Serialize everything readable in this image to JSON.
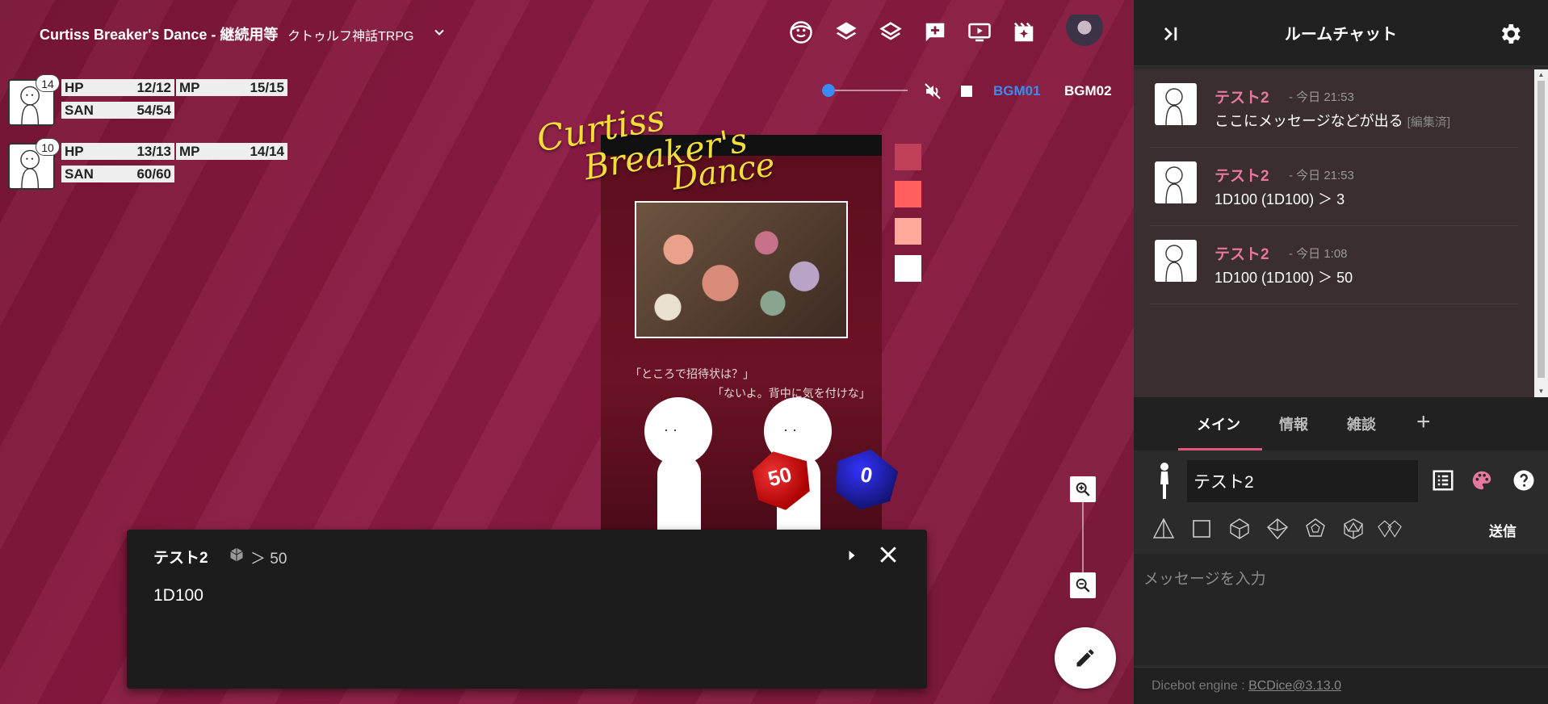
{
  "room": {
    "title": "Curtiss Breaker's Dance - 継続用等",
    "system": "クトゥルフ神話TRPG"
  },
  "toolbar_icons": [
    "face-icon",
    "layers-icon",
    "layers-outline-icon",
    "add-comment-icon",
    "screen-icon",
    "movie-sparkle-icon"
  ],
  "audio": {
    "volume": 0.05,
    "bgm1": "BGM01",
    "bgm2": "BGM02",
    "bgm1_color": "#3b8bf3"
  },
  "characters": [
    {
      "initiative": "14",
      "hp_label": "HP",
      "hp": "12/12",
      "mp_label": "MP",
      "mp": "15/15",
      "san_label": "SAN",
      "san": "54/54"
    },
    {
      "initiative": "10",
      "hp_label": "HP",
      "hp": "13/13",
      "mp_label": "MP",
      "mp": "14/14",
      "san_label": "SAN",
      "san": "60/60"
    }
  ],
  "poster": {
    "logo_line1": "Curtiss",
    "logo_line2": "Breaker's",
    "logo_line3": "Dance",
    "quote1": "「ところで招待状は？」",
    "quote2": "「ないよ。背中に気を付けな」"
  },
  "swatches": [
    "#c0405a",
    "#ff5f5f",
    "#ffaa9a",
    "#ffffff"
  ],
  "dice_faces": {
    "red": "50",
    "blue": "0"
  },
  "dice_result": {
    "name": "テスト2",
    "result": "＞ 50",
    "command": "1D100"
  },
  "chat": {
    "title": "ルームチャット",
    "messages": [
      {
        "name": "テスト2",
        "time": "- 今日 21:53",
        "text": "ここにメッセージなどが出る",
        "edited": "[編集済]"
      },
      {
        "name": "テスト2",
        "time": "- 今日 21:53",
        "text": "1D100  (1D100) ＞ 3",
        "edited": ""
      },
      {
        "name": "テスト2",
        "time": "- 今日 1:08",
        "text": "1D100  (1D100) ＞ 50",
        "edited": ""
      }
    ],
    "tabs": [
      "メイン",
      "情報",
      "雑談"
    ],
    "add_tab": "+",
    "speaker_name": "テスト2",
    "send_label": "送信",
    "message_placeholder": "メッセージを入力",
    "footer_label": "Dicebot engine : ",
    "footer_link": "BCDice@3.13.0",
    "accent": "#e678a0"
  }
}
